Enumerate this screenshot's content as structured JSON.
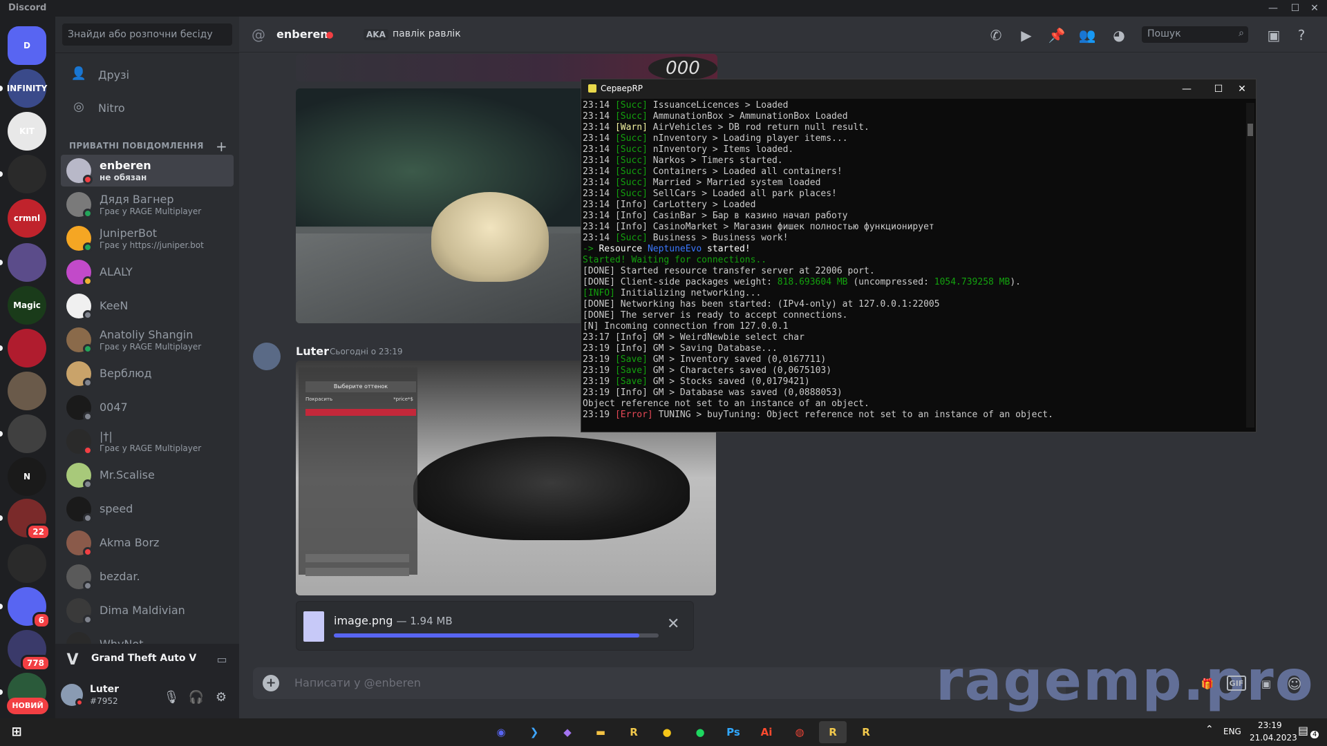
{
  "window": {
    "title": "Discord",
    "min": "—",
    "max": "☐",
    "close": "✕"
  },
  "guilds": [
    {
      "label": "D",
      "color": "#5865f2",
      "name": "home"
    },
    {
      "label": "INFINITY",
      "color": "#3a4a8a"
    },
    {
      "label": "KIT",
      "color": "#e8e8e8"
    },
    {
      "label": "",
      "color": "#2a2a2a"
    },
    {
      "label": "crmnl",
      "color": "#c0232c"
    },
    {
      "label": "",
      "color": "#5b4c8a"
    },
    {
      "label": "Magic",
      "color": "#1a3b1a"
    },
    {
      "label": "",
      "color": "#b01c2e"
    },
    {
      "label": "",
      "color": "#6a5a4a"
    },
    {
      "label": "",
      "color": "#404040"
    },
    {
      "label": "N",
      "color": "#1a1a1a"
    },
    {
      "label": "",
      "color": "#7a2a2a",
      "badge": "22"
    },
    {
      "label": "",
      "color": "#2a2a2a"
    },
    {
      "label": "",
      "color": "#5865f2",
      "badge": "6"
    },
    {
      "label": "",
      "color": "#3a3a6a",
      "badge": "778"
    },
    {
      "label": "",
      "color": "#2a5a3a"
    }
  ],
  "new_badge": "НОВИЙ",
  "dmcol": {
    "search_placeholder": "Знайди або розпочни бесіду",
    "friends": "Друзі",
    "nitro": "Nitro",
    "section_title": "ПРИВАТНІ ПОВІДОМЛЕННЯ",
    "add": "+",
    "dms": [
      {
        "name": "enberen",
        "sub": "не обязан",
        "status": "#f23f43",
        "avatar": "#b8b8c8",
        "active": true
      },
      {
        "name": "Дядя Вагнер",
        "sub": "Грає у RAGE Multiplayer",
        "status": "#23a55a",
        "avatar": "#7a7a7a"
      },
      {
        "name": "JuniperBot",
        "sub": "Грає у https://juniper.bot",
        "status": "#23a55a",
        "avatar": "#f5a623"
      },
      {
        "name": "ALALY",
        "sub": "",
        "status": "#f0b232",
        "avatar": "#c24ac9"
      },
      {
        "name": "KeeN",
        "sub": "",
        "status": "#80848e",
        "avatar": "#f0f0f0"
      },
      {
        "name": "Anatoliy Shangin",
        "sub": "Грає у RAGE Multiplayer",
        "status": "#23a55a",
        "avatar": "#8a6a4a"
      },
      {
        "name": "Верблюд",
        "sub": "",
        "status": "#80848e",
        "avatar": "#c9a36a"
      },
      {
        "name": "0047",
        "sub": "",
        "status": "#80848e",
        "avatar": "#1a1a1a"
      },
      {
        "name": "|†|",
        "sub": "Грає у RAGE Multiplayer",
        "status": "#f23f43",
        "avatar": "#2a2a2a"
      },
      {
        "name": "Mr.Scalise",
        "sub": "",
        "status": "#80848e",
        "avatar": "#a8c97a"
      },
      {
        "name": "speed",
        "sub": "",
        "status": "#80848e",
        "avatar": "#1a1a1a"
      },
      {
        "name": "Akma Borz",
        "sub": "",
        "status": "#f23f43",
        "avatar": "#8a5a4a"
      },
      {
        "name": "bezdar.",
        "sub": "",
        "status": "#80848e",
        "avatar": "#5a5a5a"
      },
      {
        "name": "Dima Maldivian",
        "sub": "",
        "status": "#80848e",
        "avatar": "#3a3a3a"
      },
      {
        "name": "WhyNot",
        "sub": "",
        "status": "#80848e",
        "avatar": "#2a2a2a"
      }
    ],
    "activity_game": "Grand Theft Auto V",
    "user": {
      "name": "Luter",
      "tag": "#7952"
    }
  },
  "header": {
    "channel": "enberen",
    "aka": "AKA",
    "aka_name": "павлік равлік",
    "search_placeholder": "Пошук"
  },
  "message": {
    "author": "Luter",
    "time": "Сьогодні о 23:19"
  },
  "upload": {
    "filename": "image.png",
    "size": "— 1.94 MB",
    "progress_pct": 94
  },
  "composer": {
    "placeholder": "Написати у @enberen",
    "gift": "🎁",
    "gif": "GIF",
    "sticker": "▣",
    "emoji": "☺"
  },
  "watermark": "ragemp.pro",
  "console": {
    "title": "СерверRP",
    "lines": [
      [
        {
          "t": "23:14 "
        },
        {
          "t": "[Succ]",
          "c": "#13a10e"
        },
        {
          "t": " IssuanceLicences > Loaded"
        }
      ],
      [
        {
          "t": "23:14 "
        },
        {
          "t": "[Succ]",
          "c": "#13a10e"
        },
        {
          "t": " AmmunationBox > AmmunationBox Loaded"
        }
      ],
      [
        {
          "t": "23:14 "
        },
        {
          "t": "[Warn]",
          "c": "#f2f2a0"
        },
        {
          "t": " AirVehicles > DB rod return null result."
        }
      ],
      [
        {
          "t": "23:14 "
        },
        {
          "t": "[Succ]",
          "c": "#13a10e"
        },
        {
          "t": " nInventory > Loading player items..."
        }
      ],
      [
        {
          "t": "23:14 "
        },
        {
          "t": "[Succ]",
          "c": "#13a10e"
        },
        {
          "t": " nInventory > Items loaded."
        }
      ],
      [
        {
          "t": "23:14 "
        },
        {
          "t": "[Succ]",
          "c": "#13a10e"
        },
        {
          "t": " Narkos > Timers started."
        }
      ],
      [
        {
          "t": "23:14 "
        },
        {
          "t": "[Succ]",
          "c": "#13a10e"
        },
        {
          "t": " Containers > Loaded all containers!"
        }
      ],
      [
        {
          "t": "23:14 "
        },
        {
          "t": "[Succ]",
          "c": "#13a10e"
        },
        {
          "t": " Married > Married system loaded"
        }
      ],
      [
        {
          "t": "23:14 "
        },
        {
          "t": "[Succ]",
          "c": "#13a10e"
        },
        {
          "t": " SellCars > Loaded all park places!"
        }
      ],
      [
        {
          "t": "23:14 [Info] CarLottery > Loaded"
        }
      ],
      [
        {
          "t": "23:14 [Info] CasinBar > Бар в казино начал работу"
        }
      ],
      [
        {
          "t": "23:14 [Info] CasinoMarket > Магазин фишек полностью функционирует"
        }
      ],
      [
        {
          "t": "23:14 "
        },
        {
          "t": "[Succ]",
          "c": "#13a10e"
        },
        {
          "t": " Business > Business work!"
        }
      ],
      [
        {
          "t": "-> ",
          "c": "#13a10e"
        },
        {
          "t": "Resource ",
          "c": "#ffffff"
        },
        {
          "t": "NeptuneEvo",
          "c": "#3b78ff"
        },
        {
          "t": " started!",
          "c": "#ffffff"
        }
      ],
      [
        {
          "t": "Started! Waiting for connections..",
          "c": "#13a10e"
        }
      ],
      [
        {
          "t": "[DONE] Started resource transfer server at 22006 port."
        }
      ],
      [
        {
          "t": "[DONE] Client-side packages weight: "
        },
        {
          "t": "818.693604 MB",
          "c": "#13a10e"
        },
        {
          "t": " (uncompressed: "
        },
        {
          "t": "1054.739258 MB",
          "c": "#13a10e"
        },
        {
          "t": ")."
        }
      ],
      [
        {
          "t": "[INFO]",
          "c": "#13a10e"
        },
        {
          "t": " Initializing networking..."
        }
      ],
      [
        {
          "t": "[DONE] Networking has been started: (IPv4-only) at 127.0.0.1:22005"
        }
      ],
      [
        {
          "t": "[DONE] The server is ready to accept connections."
        }
      ],
      [
        {
          "t": "[N] Incoming connection from 127.0.0.1"
        }
      ],
      [
        {
          "t": "23:17 [Info] GM > WeirdNewbie select char"
        }
      ],
      [
        {
          "t": "23:19 [Info] GM > Saving Database..."
        }
      ],
      [
        {
          "t": "23:19 "
        },
        {
          "t": "[Save]",
          "c": "#13a10e"
        },
        {
          "t": " GM > Inventory saved (0,0167711)"
        }
      ],
      [
        {
          "t": "23:19 "
        },
        {
          "t": "[Save]",
          "c": "#13a10e"
        },
        {
          "t": " GM > Characters saved (0,0675103)"
        }
      ],
      [
        {
          "t": "23:19 "
        },
        {
          "t": "[Save]",
          "c": "#13a10e"
        },
        {
          "t": " GM > Stocks saved (0,0179421)"
        }
      ],
      [
        {
          "t": "23:19 [Info] GM > Database was saved (0,0888053)"
        }
      ],
      [
        {
          "t": "Object reference not set to an instance of an object."
        }
      ],
      [
        {
          "t": "23:19 "
        },
        {
          "t": "[Error]",
          "c": "#e74856"
        },
        {
          "t": " TUNING > buyTuning: Object reference not set to an instance of an object."
        }
      ]
    ]
  },
  "shot3_menu": {
    "title": "Выберите оттенок",
    "row": "Покрасить",
    "price": "*price*$"
  },
  "taskbar": {
    "apps": [
      {
        "name": "discord",
        "label": "◉",
        "color": "#5865f2"
      },
      {
        "name": "vscode",
        "label": "❯",
        "color": "#3ea6ff"
      },
      {
        "name": "visual-studio",
        "label": "◆",
        "color": "#a374f0"
      },
      {
        "name": "explorer",
        "label": "▬",
        "color": "#f3c244"
      },
      {
        "name": "rage",
        "label": "R",
        "color": "#f2c94c"
      },
      {
        "name": "app-yellow",
        "label": "●",
        "color": "#f5c518"
      },
      {
        "name": "spotify",
        "label": "●",
        "color": "#1ed760"
      },
      {
        "name": "photoshop",
        "label": "Ps",
        "color": "#31a8ff"
      },
      {
        "name": "illustrator",
        "label": "Ai",
        "color": "#ff4a2e"
      },
      {
        "name": "chrome",
        "label": "◍",
        "color": "#ea4335"
      },
      {
        "name": "rage-active",
        "label": "R",
        "color": "#f2c94c",
        "active": true
      },
      {
        "name": "rage-2",
        "label": "R",
        "color": "#f2c94c"
      }
    ],
    "lang": "ENG",
    "time": "23:19",
    "date": "21.04.2023",
    "notif": "4"
  }
}
